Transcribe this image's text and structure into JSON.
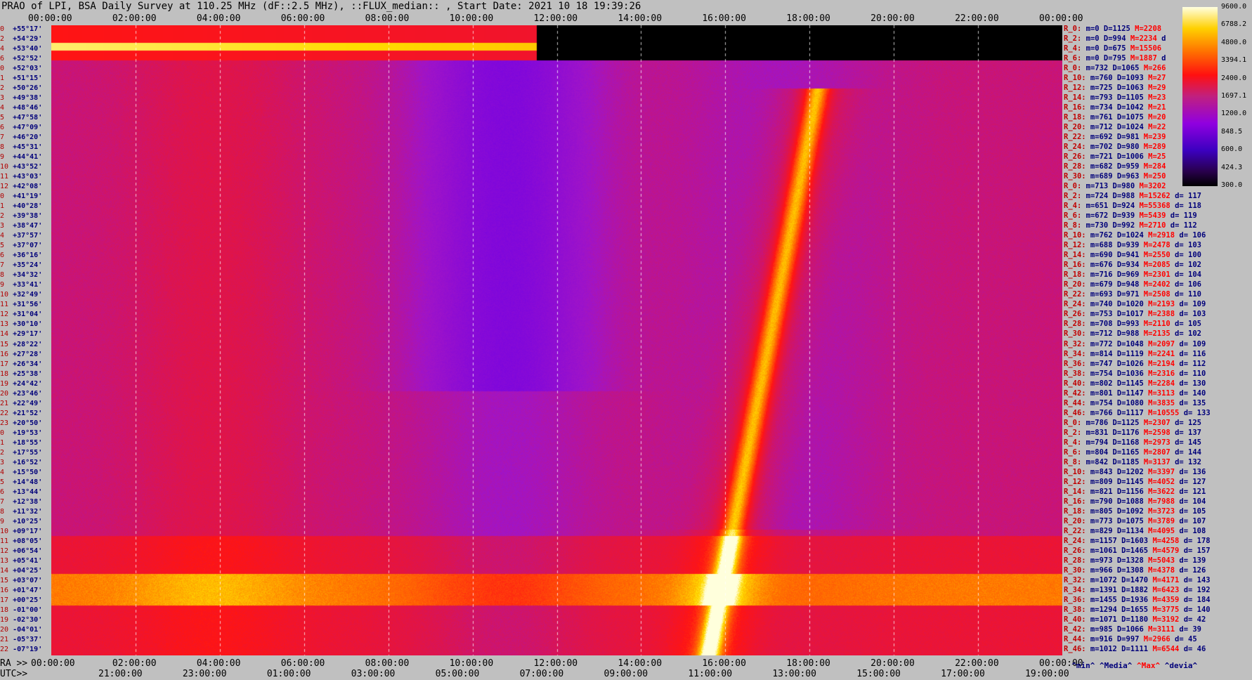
{
  "title": "PRAO of LPI, BSA Daily Survey at 110.25 MHz (dF::2.5 MHz), ::FLUX_median:: , Start Date: 2021 10 18 19:39:26",
  "top_axis_ticks": [
    "00:00:00",
    "02:00:00",
    "04:00:00",
    "06:00:00",
    "08:00:00",
    "10:00:00",
    "12:00:00",
    "14:00:00",
    "16:00:00",
    "18:00:00",
    "20:00:00",
    "22:00:00",
    "00:00:00"
  ],
  "bottom_ra_label": "RA >>",
  "bottom_ra_ticks": [
    "00:00:00",
    "02:00:00",
    "04:00:00",
    "06:00:00",
    "08:00:00",
    "10:00:00",
    "12:00:00",
    "14:00:00",
    "16:00:00",
    "18:00:00",
    "20:00:00",
    "22:00:00",
    "00:00:00"
  ],
  "bottom_utc_label": "UTC>>",
  "bottom_utc_ticks": [
    "21:00:00",
    "23:00:00",
    "01:00:00",
    "03:00:00",
    "05:00:00",
    "07:00:00",
    "09:00:00",
    "11:00:00",
    "13:00:00",
    "15:00:00",
    "17:00:00",
    "19:00:00"
  ],
  "colorbar": {
    "labels": [
      "9600.0",
      "6788.2",
      "4800.0",
      "3394.1",
      "2400.0",
      "1697.1",
      "1200.0",
      "848.5",
      "600.0",
      "424.3",
      "300.0"
    ],
    "colors": [
      "#000000",
      "#3c00c0",
      "#9000e0",
      "#c02080",
      "#ff1010",
      "#ff7000",
      "#ffd000",
      "#ffffe0"
    ]
  },
  "declinations": [
    {
      "n": "0",
      "v": "+55°17'"
    },
    {
      "n": "2",
      "v": "+54°29'"
    },
    {
      "n": "4",
      "v": "+53°40'"
    },
    {
      "n": "6",
      "v": "+52°52'"
    },
    {
      "n": "0",
      "v": "+52°03'"
    },
    {
      "n": "1",
      "v": "+51°15'"
    },
    {
      "n": "2",
      "v": "+50°26'"
    },
    {
      "n": "3",
      "v": "+49°38'"
    },
    {
      "n": "4",
      "v": "+48°46'"
    },
    {
      "n": "5",
      "v": "+47°58'"
    },
    {
      "n": "6",
      "v": "+47°09'"
    },
    {
      "n": "7",
      "v": "+46°20'"
    },
    {
      "n": "8",
      "v": "+45°31'"
    },
    {
      "n": "9",
      "v": "+44°41'"
    },
    {
      "n": "10",
      "v": "+43°52'"
    },
    {
      "n": "11",
      "v": "+43°03'"
    },
    {
      "n": "12",
      "v": "+42°08'"
    },
    {
      "n": "0",
      "v": "+41°19'"
    },
    {
      "n": "1",
      "v": "+40°28'"
    },
    {
      "n": "2",
      "v": "+39°38'"
    },
    {
      "n": "3",
      "v": "+38°47'"
    },
    {
      "n": "4",
      "v": "+37°57'"
    },
    {
      "n": "5",
      "v": "+37°07'"
    },
    {
      "n": "6",
      "v": "+36°16'"
    },
    {
      "n": "7",
      "v": "+35°24'"
    },
    {
      "n": "8",
      "v": "+34°32'"
    },
    {
      "n": "9",
      "v": "+33°41'"
    },
    {
      "n": "10",
      "v": "+32°49'"
    },
    {
      "n": "11",
      "v": "+31°56'"
    },
    {
      "n": "12",
      "v": "+31°04'"
    },
    {
      "n": "13",
      "v": "+30°10'"
    },
    {
      "n": "14",
      "v": "+29°17'"
    },
    {
      "n": "15",
      "v": "+28°22'"
    },
    {
      "n": "16",
      "v": "+27°28'"
    },
    {
      "n": "17",
      "v": "+26°34'"
    },
    {
      "n": "18",
      "v": "+25°38'"
    },
    {
      "n": "19",
      "v": "+24°42'"
    },
    {
      "n": "20",
      "v": "+23°46'"
    },
    {
      "n": "21",
      "v": "+22°49'"
    },
    {
      "n": "22",
      "v": "+21°52'"
    },
    {
      "n": "23",
      "v": "+20°50'"
    },
    {
      "n": "0",
      "v": "+19°53'"
    },
    {
      "n": "1",
      "v": "+18°55'"
    },
    {
      "n": "2",
      "v": "+17°55'"
    },
    {
      "n": "3",
      "v": "+16°52'"
    },
    {
      "n": "4",
      "v": "+15°50'"
    },
    {
      "n": "5",
      "v": "+14°48'"
    },
    {
      "n": "6",
      "v": "+13°44'"
    },
    {
      "n": "7",
      "v": "+12°38'"
    },
    {
      "n": "8",
      "v": "+11°32'"
    },
    {
      "n": "9",
      "v": "+10°25'"
    },
    {
      "n": "10",
      "v": "+09°17'"
    },
    {
      "n": "11",
      "v": "+08°05'"
    },
    {
      "n": "12",
      "v": "+06°54'"
    },
    {
      "n": "13",
      "v": "+05°41'"
    },
    {
      "n": "14",
      "v": "+04°25'"
    },
    {
      "n": "15",
      "v": "+03°07'"
    },
    {
      "n": "16",
      "v": "+01°47'"
    },
    {
      "n": "17",
      "v": "+00°25'"
    },
    {
      "n": "18",
      "v": "-01°00'"
    },
    {
      "n": "19",
      "v": "-02°30'"
    },
    {
      "n": "20",
      "v": "-04°01'"
    },
    {
      "n": "21",
      "v": "-05°37'"
    },
    {
      "n": "22",
      "v": "-07°19'"
    }
  ],
  "stats": [
    {
      "r": "R_0:",
      "t": " m=0 D=1125 ",
      "m": "M=2208",
      "d": ""
    },
    {
      "r": "R_2:",
      "t": " m=0 D=994 ",
      "m": "M=2234",
      "d": " d"
    },
    {
      "r": "R_4:",
      "t": " m=0 D=675 ",
      "m": "M=15506",
      "d": ""
    },
    {
      "r": "R_6:",
      "t": " m=0 D=795 ",
      "m": "M=1887",
      "d": " d"
    },
    {
      "r": "R_0:",
      "t": " m=732 D=1065 ",
      "m": "M=266",
      "d": ""
    },
    {
      "r": "R_10:",
      "t": " m=760 D=1093 ",
      "m": "M=27",
      "d": ""
    },
    {
      "r": "R_12:",
      "t": " m=725 D=1063 ",
      "m": "M=29",
      "d": ""
    },
    {
      "r": "R_14:",
      "t": " m=793 D=1105 ",
      "m": "M=23",
      "d": ""
    },
    {
      "r": "R_16:",
      "t": " m=734 D=1042 ",
      "m": "M=21",
      "d": ""
    },
    {
      "r": "R_18:",
      "t": " m=761 D=1075 ",
      "m": "M=20",
      "d": ""
    },
    {
      "r": "R_20:",
      "t": " m=712 D=1024 ",
      "m": "M=22",
      "d": ""
    },
    {
      "r": "R_22:",
      "t": " m=692 D=981 ",
      "m": "M=239",
      "d": ""
    },
    {
      "r": "R_24:",
      "t": " m=702 D=980 ",
      "m": "M=289",
      "d": ""
    },
    {
      "r": "R_26:",
      "t": " m=721 D=1006 ",
      "m": "M=25",
      "d": ""
    },
    {
      "r": "R_28:",
      "t": " m=682 D=959 ",
      "m": "M=284",
      "d": ""
    },
    {
      "r": "R_30:",
      "t": " m=689 D=963 ",
      "m": "M=250",
      "d": ""
    },
    {
      "r": "R_0:",
      "t": " m=713 D=980 ",
      "m": "M=3202",
      "d": ""
    },
    {
      "r": "R_2:",
      "t": " m=724 D=988 ",
      "m": "M=15262",
      "d": " d= 117"
    },
    {
      "r": "R_4:",
      "t": " m=651 D=924 ",
      "m": "M=55368",
      "d": " d= 118"
    },
    {
      "r": "R_6:",
      "t": " m=672 D=939 ",
      "m": "M=5439",
      "d": " d= 119"
    },
    {
      "r": "R_8:",
      "t": " m=730 D=992 ",
      "m": "M=2710",
      "d": " d= 112"
    },
    {
      "r": "R_10:",
      "t": " m=762 D=1024 ",
      "m": "M=2918",
      "d": " d= 106"
    },
    {
      "r": "R_12:",
      "t": " m=688 D=939 ",
      "m": "M=2478",
      "d": " d= 103"
    },
    {
      "r": "R_14:",
      "t": " m=690 D=941 ",
      "m": "M=2550",
      "d": " d= 100"
    },
    {
      "r": "R_16:",
      "t": " m=676 D=934 ",
      "m": "M=2085",
      "d": " d= 102"
    },
    {
      "r": "R_18:",
      "t": " m=716 D=969 ",
      "m": "M=2301",
      "d": " d= 104"
    },
    {
      "r": "R_20:",
      "t": " m=679 D=948 ",
      "m": "M=2402",
      "d": " d= 106"
    },
    {
      "r": "R_22:",
      "t": " m=693 D=971 ",
      "m": "M=2508",
      "d": " d= 110"
    },
    {
      "r": "R_24:",
      "t": " m=740 D=1020 ",
      "m": "M=2193",
      "d": " d= 109"
    },
    {
      "r": "R_26:",
      "t": " m=753 D=1017 ",
      "m": "M=2388",
      "d": " d= 103"
    },
    {
      "r": "R_28:",
      "t": " m=708 D=993 ",
      "m": "M=2110",
      "d": " d= 105"
    },
    {
      "r": "R_30:",
      "t": " m=712 D=988 ",
      "m": "M=2135",
      "d": " d= 102"
    },
    {
      "r": "R_32:",
      "t": " m=772 D=1048 ",
      "m": "M=2097",
      "d": " d= 109"
    },
    {
      "r": "R_34:",
      "t": " m=814 D=1119 ",
      "m": "M=2241",
      "d": " d= 116"
    },
    {
      "r": "R_36:",
      "t": " m=747 D=1026 ",
      "m": "M=2194",
      "d": " d= 112"
    },
    {
      "r": "R_38:",
      "t": " m=754 D=1036 ",
      "m": "M=2316",
      "d": " d= 110"
    },
    {
      "r": "R_40:",
      "t": " m=802 D=1145 ",
      "m": "M=2284",
      "d": " d= 130"
    },
    {
      "r": "R_42:",
      "t": " m=801 D=1147 ",
      "m": "M=3113",
      "d": " d= 140"
    },
    {
      "r": "R_44:",
      "t": " m=754 D=1080 ",
      "m": "M=3835",
      "d": " d= 135"
    },
    {
      "r": "R_46:",
      "t": " m=766 D=1117 ",
      "m": "M=10555",
      "d": " d= 133"
    },
    {
      "r": "R_0:",
      "t": " m=786 D=1125 ",
      "m": "M=2307",
      "d": " d= 125"
    },
    {
      "r": "R_2:",
      "t": " m=831 D=1176 ",
      "m": "M=2598",
      "d": " d= 137"
    },
    {
      "r": "R_4:",
      "t": " m=794 D=1168 ",
      "m": "M=2973",
      "d": " d= 145"
    },
    {
      "r": "R_6:",
      "t": " m=804 D=1165 ",
      "m": "M=2807",
      "d": " d= 144"
    },
    {
      "r": "R_8:",
      "t": " m=842 D=1185 ",
      "m": "M=3137",
      "d": " d= 132"
    },
    {
      "r": "R_10:",
      "t": " m=843 D=1202 ",
      "m": "M=3397",
      "d": " d= 136"
    },
    {
      "r": "R_12:",
      "t": " m=809 D=1145 ",
      "m": "M=4052",
      "d": " d= 127"
    },
    {
      "r": "R_14:",
      "t": " m=821 D=1156 ",
      "m": "M=3622",
      "d": " d= 121"
    },
    {
      "r": "R_16:",
      "t": " m=790 D=1088 ",
      "m": "M=7988",
      "d": " d= 104"
    },
    {
      "r": "R_18:",
      "t": " m=805 D=1092 ",
      "m": "M=3723",
      "d": " d= 105"
    },
    {
      "r": "R_20:",
      "t": " m=773 D=1075 ",
      "m": "M=3789",
      "d": " d= 107"
    },
    {
      "r": "R_22:",
      "t": " m=829 D=1134 ",
      "m": "M=4095",
      "d": " d= 108"
    },
    {
      "r": "R_24:",
      "t": " m=1157 D=1603 ",
      "m": "M=4258",
      "d": " d= 178"
    },
    {
      "r": "R_26:",
      "t": " m=1061 D=1465 ",
      "m": "M=4579",
      "d": " d= 157"
    },
    {
      "r": "R_28:",
      "t": " m=973 D=1328 ",
      "m": "M=5043",
      "d": " d= 139"
    },
    {
      "r": "R_30:",
      "t": " m=966 D=1308 ",
      "m": "M=4378",
      "d": " d= 126"
    },
    {
      "r": "R_32:",
      "t": " m=1072 D=1470 ",
      "m": "M=4171",
      "d": " d= 143"
    },
    {
      "r": "R_34:",
      "t": " m=1391 D=1882 ",
      "m": "M=6423",
      "d": " d= 192"
    },
    {
      "r": "R_36:",
      "t": " m=1455 D=1936 ",
      "m": "M=4359",
      "d": " d= 184"
    },
    {
      "r": "R_38:",
      "t": " m=1294 D=1655 ",
      "m": "M=3775",
      "d": " d= 140"
    },
    {
      "r": "R_40:",
      "t": " m=1071 D=1180 ",
      "m": "M=3192",
      "d": " d= 42"
    },
    {
      "r": "R_42:",
      "t": " m=985 D=1066 ",
      "m": "M=3111",
      "d": " d= 39"
    },
    {
      "r": "R_44:",
      "t": " m=916 D=997 ",
      "m": "M=2966",
      "d": " d= 45"
    },
    {
      "r": "R_46:",
      "t": " m=1012 D=1111 ",
      "m": "M=6544",
      "d": " d= 46"
    }
  ],
  "legend": {
    "min": "^min^",
    "median": " ^Media^",
    "max": " ^Max^",
    "devia": " ^devia^"
  }
}
